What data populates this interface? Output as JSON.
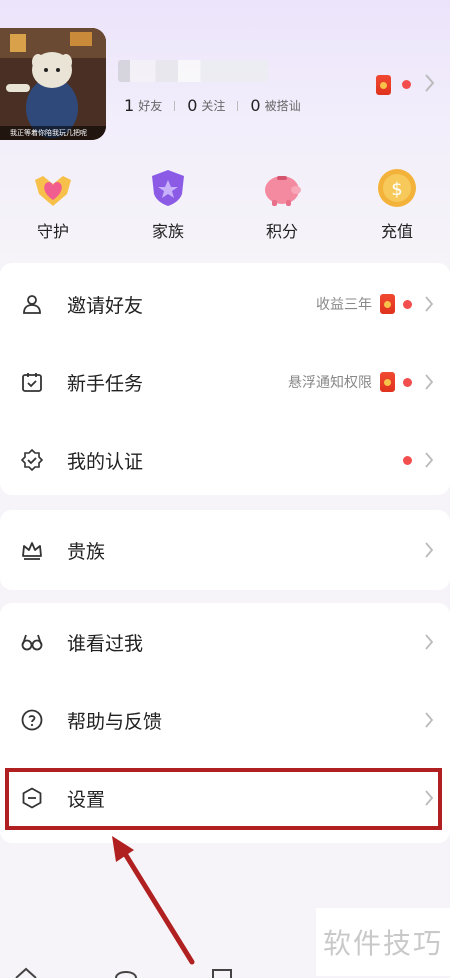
{
  "profile": {
    "avatar_caption": "我正等着你陪我玩几把呢",
    "stats": [
      {
        "value": "1",
        "label": "好友"
      },
      {
        "value": "0",
        "label": "关注"
      },
      {
        "value": "0",
        "label": "被搭讪"
      }
    ]
  },
  "quick_actions": [
    {
      "label": "守护",
      "icon": "guard-heart-icon"
    },
    {
      "label": "家族",
      "icon": "family-shield-icon"
    },
    {
      "label": "积分",
      "icon": "piggy-bank-icon"
    },
    {
      "label": "充值",
      "icon": "coin-icon"
    }
  ],
  "menu_group_1": [
    {
      "label": "邀请好友",
      "note": "收益三年",
      "icon": "invite-friend-icon"
    },
    {
      "label": "新手任务",
      "note": "悬浮通知权限",
      "icon": "calendar-task-icon"
    },
    {
      "label": "我的认证",
      "note": "",
      "icon": "verified-badge-icon"
    }
  ],
  "menu_group_2": [
    {
      "label": "贵族",
      "icon": "crown-icon"
    }
  ],
  "menu_group_3": [
    {
      "label": "谁看过我",
      "icon": "glasses-icon"
    },
    {
      "label": "帮助与反馈",
      "icon": "help-icon"
    },
    {
      "label": "设置",
      "icon": "settings-icon"
    }
  ],
  "watermark": "软件技巧",
  "colors": {
    "accent_red": "#f24e4e",
    "highlight_border": "#b02020",
    "header_gradient_top": "#ece4fb"
  }
}
